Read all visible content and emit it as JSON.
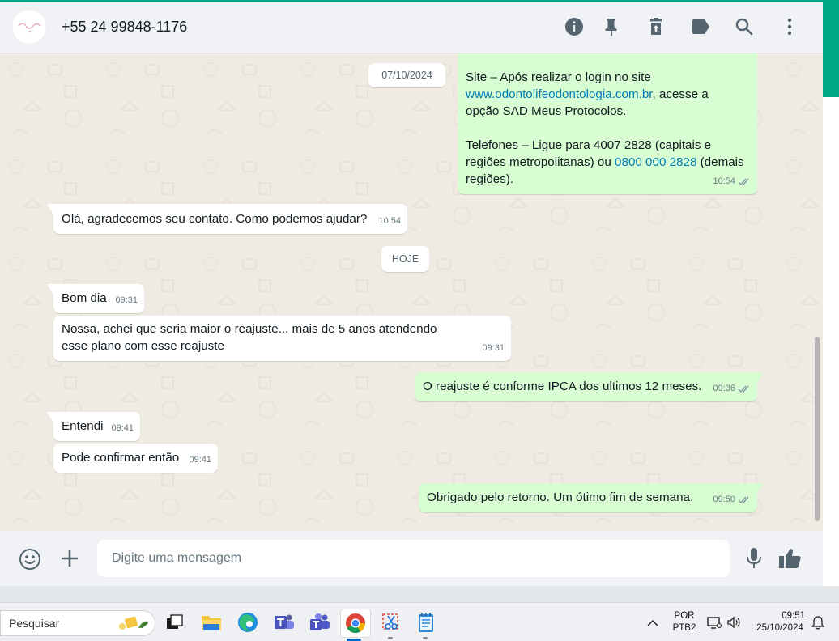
{
  "header": {
    "contact_name": "+55 24 99848-1176",
    "icons": [
      "info-icon",
      "pin-icon",
      "trash-icon",
      "label-icon",
      "search-icon",
      "more-vertical-icon"
    ]
  },
  "messages": [
    {
      "type": "date",
      "text": "07/10/2024"
    },
    {
      "type": "out",
      "line1": "Site – Após realizar o login no site",
      "link1": "www.odontolifeodontologia.com.br",
      "line2": ", acesse a",
      "line3": "opção SAD Meus Protocolos.",
      "line4": "Telefones – Ligue para 4007 2828 (capitais e",
      "line5": "regiões metropolitanas) ou ",
      "link2": "0800 000 2828",
      "line6": " (demais",
      "line7": "regiões).",
      "time": "10:54",
      "status": "read"
    },
    {
      "type": "in",
      "text": "Olá, agradecemos seu contato. Como podemos ajudar?",
      "time": "10:54"
    },
    {
      "type": "date",
      "text": "HOJE"
    },
    {
      "type": "in",
      "text": "Bom dia",
      "time": "09:31"
    },
    {
      "type": "in",
      "text": "Nossa, achei que seria maior o reajuste... mais de 5 anos atendendo esse plano com esse reajuste",
      "time": "09:31"
    },
    {
      "type": "out",
      "text": "O reajuste é conforme IPCA dos ultimos 12 meses.",
      "time": "09:36",
      "status": "read"
    },
    {
      "type": "in",
      "text": "Entendi",
      "time": "09:41"
    },
    {
      "type": "in",
      "text": "Pode confirmar então",
      "time": "09:41"
    },
    {
      "type": "out",
      "text": "Obrigado pelo retorno. Um ótimo fim de semana.",
      "time": "09:50",
      "status": "read"
    }
  ],
  "composer": {
    "placeholder": "Digite uma mensagem",
    "icons": [
      "emoji-icon",
      "plus-icon",
      "microphone-icon",
      "thumbs-up-icon"
    ]
  },
  "taskbar": {
    "search_label": "Pesquisar",
    "apps": [
      "task-view-icon",
      "file-explorer-icon",
      "edge-icon",
      "teams-icon",
      "teams-work-icon",
      "chrome-icon",
      "snipping-tool-icon",
      "notepad-icon"
    ],
    "language_line1": "POR",
    "language_line2": "PTB2",
    "time": "09:51",
    "date": "25/10/2024"
  },
  "colors": {
    "accent": "#00a884",
    "incoming_bubble": "#ffffff",
    "outgoing_bubble": "#d9fdd3",
    "chat_background": "#efeae2",
    "link": "#027eb5",
    "read_check": "#8696a0"
  }
}
